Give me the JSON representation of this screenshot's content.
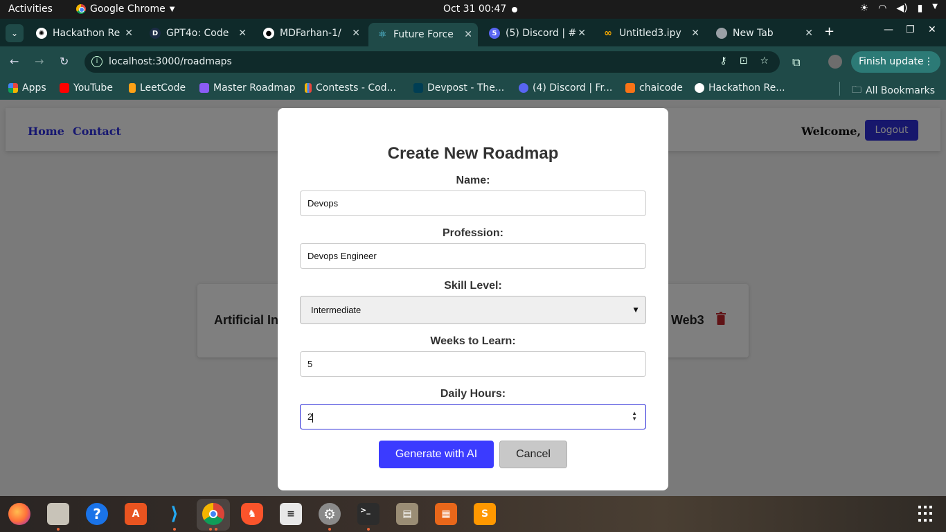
{
  "system_bar": {
    "activities": "Activities",
    "app_name": "Google Chrome",
    "clock": "Oct 31  00:47"
  },
  "tabs": [
    {
      "title": "Hackathon Re",
      "color": "#ffffff"
    },
    {
      "title": "GPT4o: Code",
      "color": "#1b2b44"
    },
    {
      "title": "MDFarhan-1/",
      "color": "#ffffff"
    },
    {
      "title": "Future Force",
      "color": "#61dafb",
      "active": true
    },
    {
      "title": "(5) Discord | #",
      "color": "#5865f2"
    },
    {
      "title": "Untitled3.ipy",
      "color": "#f9ab00"
    },
    {
      "title": "New Tab",
      "color": "#9aa0a6"
    }
  ],
  "omnibox": {
    "url": "localhost:3000/roadmaps"
  },
  "finish_update": "Finish update",
  "bookmarks": [
    {
      "label": "Apps",
      "color": "#e8453c"
    },
    {
      "label": "YouTube",
      "color": "#ff0000"
    },
    {
      "label": "LeetCode",
      "color": "#ffa116"
    },
    {
      "label": "Master Roadmap",
      "color": "#8b5cf6"
    },
    {
      "label": "Contests - Cod...",
      "color": "#e8453c"
    },
    {
      "label": "Devpost - The...",
      "color": "#003e54"
    },
    {
      "label": "(4) Discord | Fr...",
      "color": "#5865f2"
    },
    {
      "label": "chaicode",
      "color": "#f97316"
    },
    {
      "label": "Hackathon Re...",
      "color": "#333333"
    },
    {
      "label": "All Bookmarks",
      "color": "#e8f0f0"
    }
  ],
  "page": {
    "nav": {
      "home": "Home",
      "contact": "Contact",
      "welcome": "Welcome, !",
      "logout": "Logout"
    },
    "cards": {
      "left": "Artificial In",
      "right": "Web3"
    }
  },
  "modal": {
    "title": "Create New Roadmap",
    "name_label": "Name:",
    "name_value": "Devops",
    "profession_label": "Profession:",
    "profession_value": "Devops Engineer",
    "skill_label": "Skill Level:",
    "skill_value": "Intermediate",
    "weeks_label": "Weeks to Learn:",
    "weeks_value": "5",
    "hours_label": "Daily Hours:",
    "hours_value": "2",
    "generate_button": "Generate with AI",
    "cancel_button": "Cancel"
  },
  "colors": {
    "accent": "#3b3bff",
    "link": "#2d2ee0",
    "delete": "#c0262d"
  },
  "dock": [
    {
      "name": "firefox-icon",
      "color": "#ff7139",
      "running": false
    },
    {
      "name": "files-icon",
      "color": "#c8c3b8",
      "running": true
    },
    {
      "name": "help-icon",
      "color": "#1a73e8",
      "running": false
    },
    {
      "name": "app-center-icon",
      "color": "#e95420",
      "running": false
    },
    {
      "name": "vscode-icon",
      "color": "#23a9f2",
      "running": true
    },
    {
      "name": "chrome-icon",
      "color": "#4285f4",
      "running": true
    },
    {
      "name": "brave-icon",
      "color": "#fb542b",
      "running": false
    },
    {
      "name": "text-editor-icon",
      "color": "#e8e8e8",
      "running": false
    },
    {
      "name": "settings-icon",
      "color": "#8a8a8a",
      "running": true
    },
    {
      "name": "terminal-icon",
      "color": "#2c2c2c",
      "running": true
    },
    {
      "name": "archive-icon",
      "color": "#9a8d75",
      "running": false
    },
    {
      "name": "slides-icon",
      "color": "#e8671a",
      "running": false
    },
    {
      "name": "sublime-icon",
      "color": "#ff9800",
      "running": false
    }
  ]
}
